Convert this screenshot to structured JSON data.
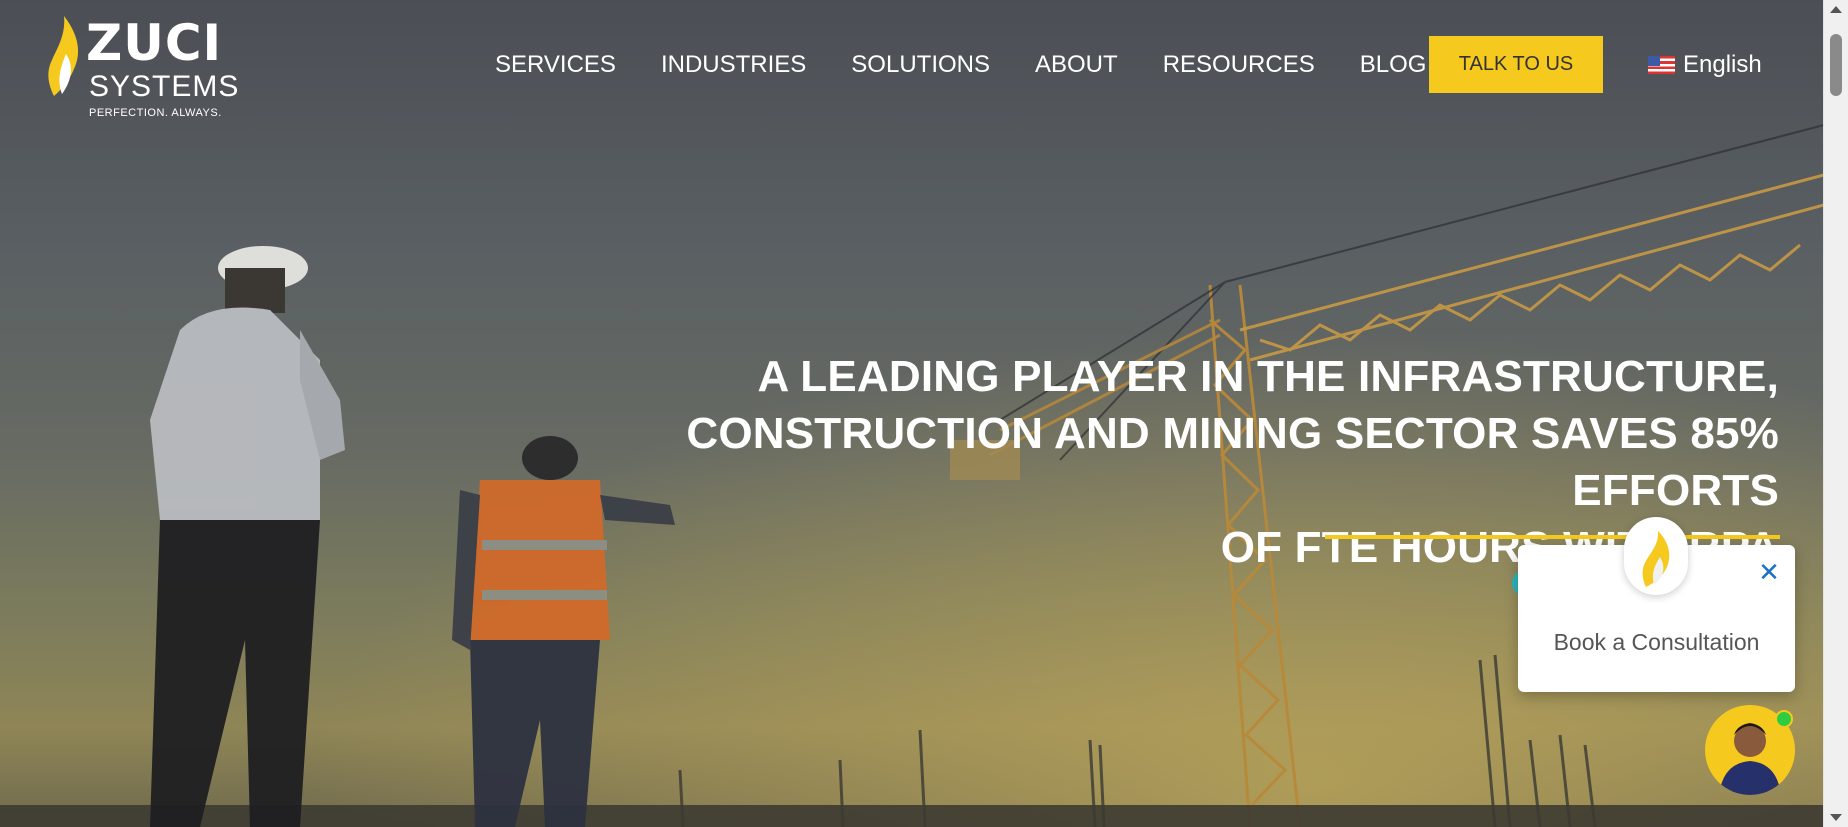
{
  "brand": {
    "name": "ZUCI",
    "subname": "SYSTEMS",
    "tagline": "PERFECTION. ALWAYS."
  },
  "nav": {
    "items": [
      {
        "label": "SERVICES"
      },
      {
        "label": "INDUSTRIES"
      },
      {
        "label": "SOLUTIONS"
      },
      {
        "label": "ABOUT"
      },
      {
        "label": "RESOURCES"
      },
      {
        "label": "BLOG"
      }
    ],
    "cta_label": "TALK TO US",
    "language": "English"
  },
  "hero": {
    "headline_line1": "A LEADING PLAYER IN THE INFRASTRUCTURE,",
    "headline_line2": "CONSTRUCTION AND MINING SECTOR SAVES 85% EFFORTS",
    "headline_line3": "OF FTE HOURS WITH RPA"
  },
  "consultation_widget": {
    "label": "Book a Consultation",
    "close_icon": "close-icon"
  },
  "colors": {
    "accent": "#f6c91e",
    "close_blue": "#1a73c8",
    "online_green": "#2ecc40"
  }
}
